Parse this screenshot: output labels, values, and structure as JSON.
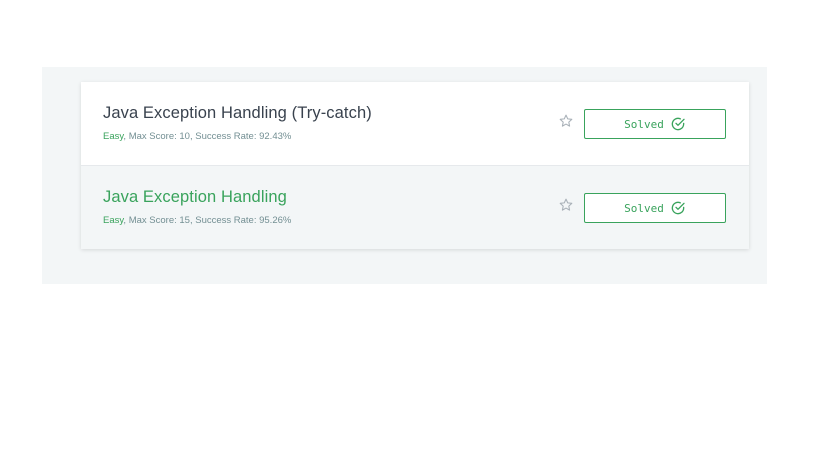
{
  "challenges": [
    {
      "title": "Java Exception Handling (Try-catch)",
      "difficulty": "Easy",
      "details": ", Max Score: 10, Success Rate: 92.43%",
      "status_label": "Solved",
      "star_icon": "star-outline-icon",
      "status_icon": "check-circle-icon"
    },
    {
      "title": "Java Exception Handling",
      "difficulty": "Easy",
      "details": ", Max Score: 15, Success Rate: 95.26%",
      "status_label": "Solved",
      "star_icon": "star-outline-icon",
      "status_icon": "check-circle-icon"
    }
  ],
  "colors": {
    "accent_green": "#39a35c",
    "title_dark": "#39424e",
    "meta_gray": "#738f93",
    "panel_bg": "#f3f6f7"
  }
}
